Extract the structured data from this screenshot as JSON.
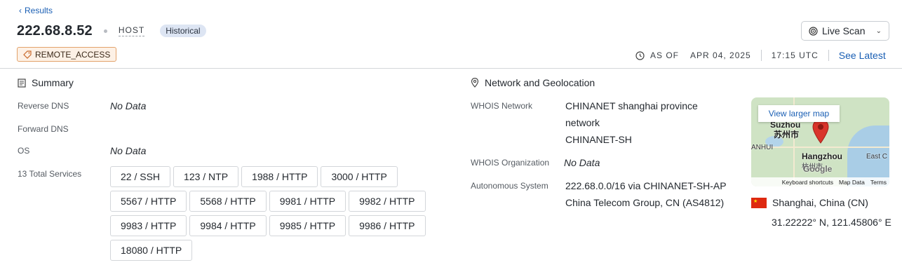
{
  "nav": {
    "back_label": "Results"
  },
  "header": {
    "ip": "222.68.8.52",
    "type_label": "HOST",
    "status_badge": "Historical",
    "live_scan_label": "Live Scan",
    "tag_label": "REMOTE_ACCESS",
    "as_of_label": "AS OF",
    "as_of_date": "APR 04, 2025",
    "as_of_time": "17:15 UTC",
    "see_latest_label": "See Latest"
  },
  "summary": {
    "title": "Summary",
    "reverse_dns_label": "Reverse DNS",
    "reverse_dns_value": "No Data",
    "forward_dns_label": "Forward DNS",
    "os_label": "OS",
    "os_value": "No Data",
    "services_label": "13 Total Services",
    "services": [
      "22 / SSH",
      "123 / NTP",
      "1988 / HTTP",
      "3000 / HTTP",
      "5567 / HTTP",
      "5568 / HTTP",
      "9981 / HTTP",
      "9982 / HTTP",
      "9983 / HTTP",
      "9984 / HTTP",
      "9985 / HTTP",
      "9986 / HTTP",
      "18080 / HTTP"
    ]
  },
  "network": {
    "title": "Network and Geolocation",
    "whois_network_label": "WHOIS Network",
    "whois_network_line1": "CHINANET shanghai province",
    "whois_network_line2": "network",
    "whois_network_line3": "CHINANET-SH",
    "whois_org_label": "WHOIS Organization",
    "whois_org_value": "No Data",
    "asn_label": "Autonomous System",
    "asn_line1": "222.68.0.0/16 via CHINANET-SH-AP",
    "asn_line2": "China Telecom Group, CN (AS4812)"
  },
  "map": {
    "larger_map_label": "View larger map",
    "city_suzhou": "Suzhou",
    "city_suzhou_cn": "苏州市",
    "city_hangzhou": "Hangzhou",
    "city_hangzhou_cn": "杭州市",
    "region_anhui": "ANHUI",
    "east_label": "East C",
    "google_label": "Google",
    "keyboard_label": "Keyboard shortcuts",
    "map_data_label": "Map Data",
    "terms_label": "Terms"
  },
  "geo": {
    "location": "Shanghai, China (CN)",
    "coordinates": "31.22222° N, 121.45806° E"
  },
  "colors": {
    "link": "#1a5fb4",
    "tag_border": "#e3a26a",
    "badge_bg": "#dde5f3",
    "pin": "#d9342b"
  }
}
